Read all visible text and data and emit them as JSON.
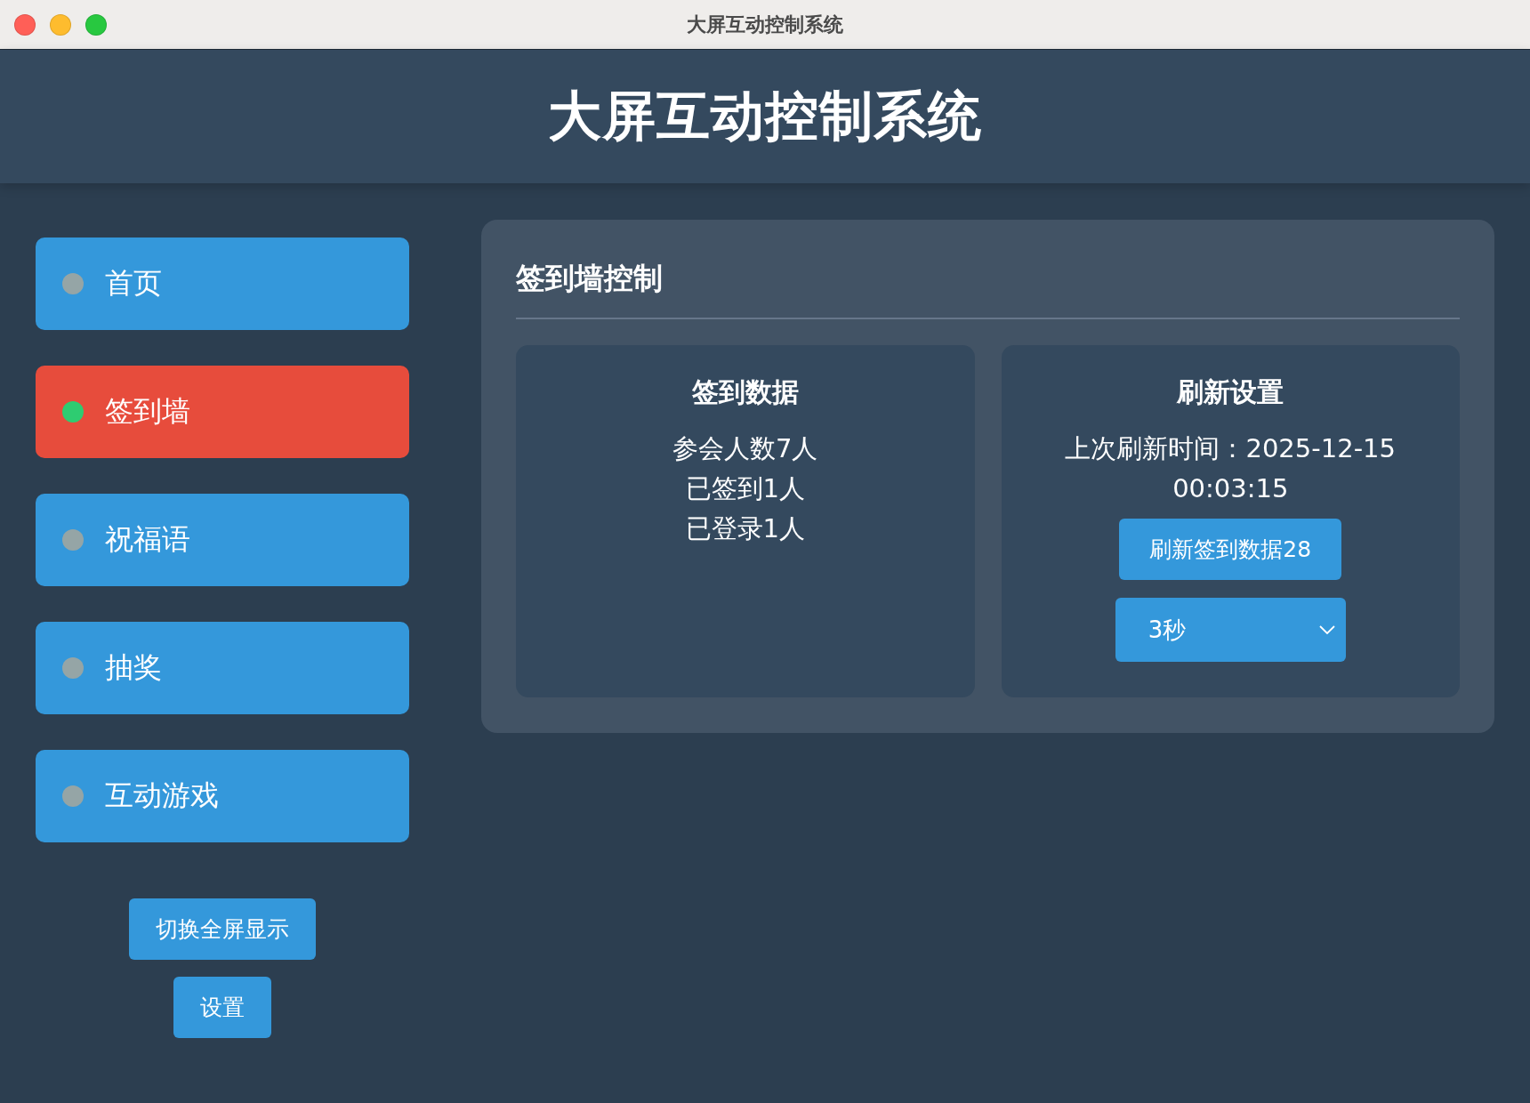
{
  "window": {
    "title": "大屏互动控制系统"
  },
  "header": {
    "title": "大屏互动控制系统"
  },
  "sidebar": {
    "items": [
      {
        "label": "首页",
        "selected": false
      },
      {
        "label": "签到墙",
        "selected": true
      },
      {
        "label": "祝福语",
        "selected": false
      },
      {
        "label": "抽奖",
        "selected": false
      },
      {
        "label": "互动游戏",
        "selected": false
      }
    ],
    "buttons": [
      "切换全屏显示",
      "设置"
    ]
  },
  "panel": {
    "title": "签到墙控制",
    "cards": [
      {
        "kind": "stats",
        "title": "签到数据",
        "lines": [
          "参会人数7人",
          "已签到1人",
          "已登录1人"
        ]
      },
      {
        "kind": "refresh",
        "title": "刷新设置",
        "last_refresh": "上次刷新时间：2025-12-15 00:03:15",
        "button": "刷新签到数据28",
        "interval": {
          "value": "3秒"
        }
      }
    ]
  }
}
